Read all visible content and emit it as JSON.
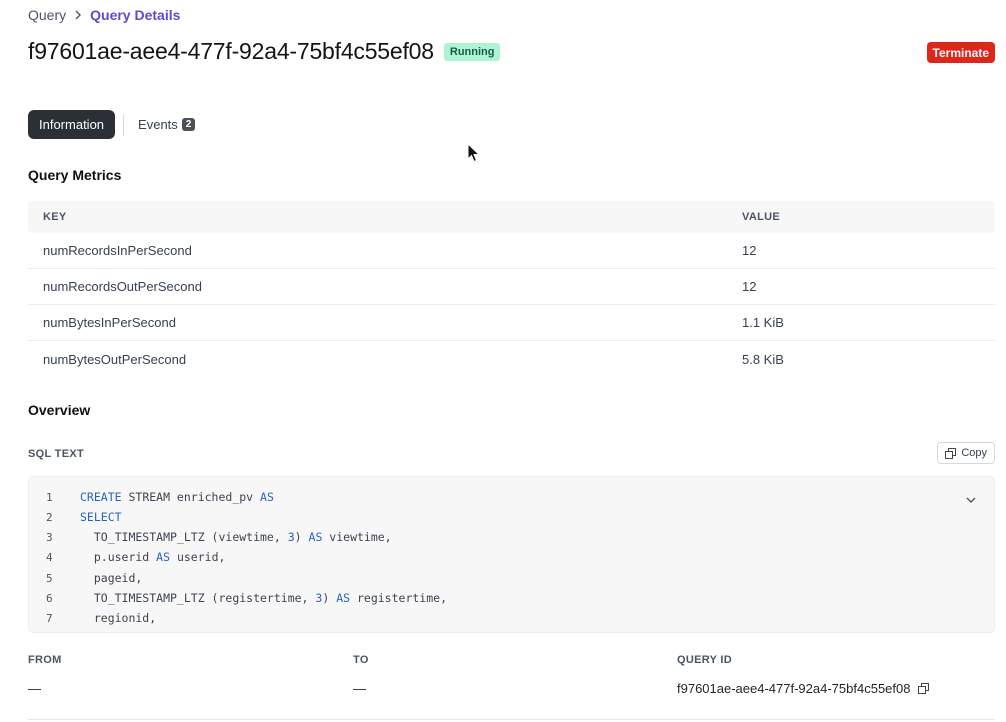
{
  "breadcrumb": {
    "root": "Query",
    "current": "Query Details"
  },
  "header": {
    "title": "f97601ae-aee4-477f-92a4-75bf4c55ef08",
    "status": "Running",
    "terminate_label": "Terminate"
  },
  "tabs": {
    "information": "Information",
    "events": "Events",
    "events_count": "2"
  },
  "metrics": {
    "title": "Query Metrics",
    "headers": {
      "key": "KEY",
      "value": "VALUE"
    },
    "rows": [
      {
        "key": "numRecordsInPerSecond",
        "value": "12"
      },
      {
        "key": "numRecordsOutPerSecond",
        "value": "12"
      },
      {
        "key": "numBytesInPerSecond",
        "value": "1.1 KiB"
      },
      {
        "key": "numBytesOutPerSecond",
        "value": "5.8 KiB"
      }
    ]
  },
  "overview": {
    "title": "Overview",
    "sql_label": "SQL TEXT",
    "copy_label": "Copy",
    "lines": [
      {
        "n": "1",
        "text": "CREATE STREAM enriched_pv AS"
      },
      {
        "n": "2",
        "text": "SELECT"
      },
      {
        "n": "3",
        "text": "  TO_TIMESTAMP_LTZ (viewtime, 3) AS viewtime,"
      },
      {
        "n": "4",
        "text": "  p.userid AS userid,"
      },
      {
        "n": "5",
        "text": "  pageid,"
      },
      {
        "n": "6",
        "text": "  TO_TIMESTAMP_LTZ (registertime, 3) AS registertime,"
      },
      {
        "n": "7",
        "text": "  regionid,"
      }
    ]
  },
  "footer": {
    "from_label": "FROM",
    "to_label": "TO",
    "query_id_label": "QUERY ID",
    "from_value": "—",
    "to_value": "—",
    "query_id_value": "f97601ae-aee4-477f-92a4-75bf4c55ef08"
  },
  "colors": {
    "accent": "#5b4ccf",
    "danger": "#e0251b",
    "success_bg": "#aef3d4",
    "keyword": "#2563c9"
  }
}
